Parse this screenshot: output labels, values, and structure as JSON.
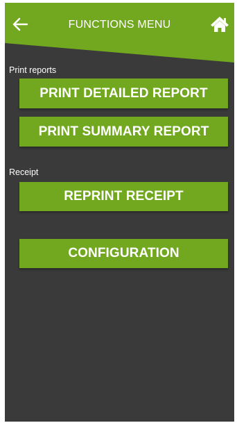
{
  "header": {
    "title": "FUNCTIONS MENU",
    "back_icon": "arrow-left-icon",
    "home_icon": "home-icon"
  },
  "sections": {
    "print_reports": {
      "label": "Print reports",
      "buttons": [
        {
          "label": "PRINT DETAILED REPORT"
        },
        {
          "label": "PRINT SUMMARY REPORT"
        }
      ]
    },
    "receipt": {
      "label": "Receipt",
      "buttons": [
        {
          "label": "REPRINT RECEIPT"
        }
      ]
    },
    "configuration": {
      "label": "CONFIGURATION"
    }
  },
  "colors": {
    "accent": "#72a81f",
    "background": "#3a3a3a",
    "text": "#ffffff"
  }
}
